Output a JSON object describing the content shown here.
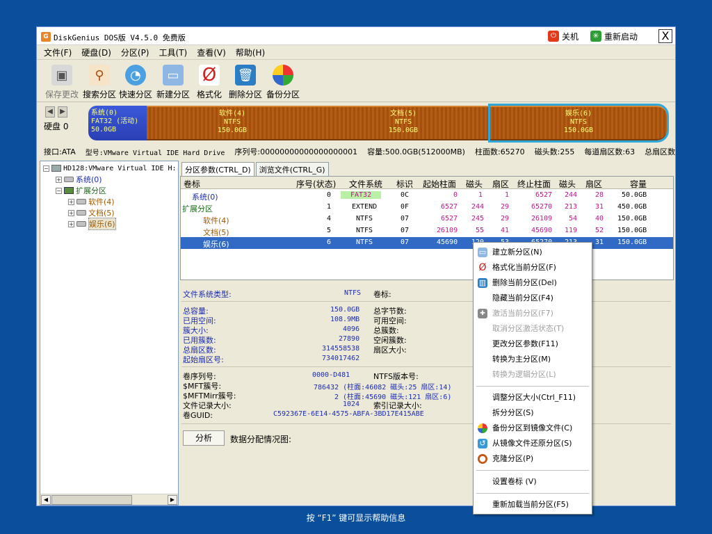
{
  "window": {
    "title": "DiskGenius DOS版 V4.5.0 免费版",
    "app_icon": "G",
    "shutdown_label": "关机",
    "restart_label": "重新启动",
    "close_label": "X"
  },
  "menu": [
    "文件(F)",
    "硬盘(D)",
    "分区(P)",
    "工具(T)",
    "查看(V)",
    "帮助(H)"
  ],
  "toolbar": [
    "保存更改",
    "搜索分区",
    "快速分区",
    "新建分区",
    "格式化",
    "删除分区",
    "备份分区"
  ],
  "diskbar": {
    "disk_label": "硬盘 0",
    "prev_arrow": "◀",
    "next_arrow": "▶",
    "parts": [
      {
        "name": "系统(0)",
        "fs": "FAT32 (活动)",
        "size": "50.0GB"
      },
      {
        "name": "软件(4)",
        "fs": "NTFS",
        "size": "150.0GB"
      },
      {
        "name": "文档(5)",
        "fs": "NTFS",
        "size": "150.0GB"
      },
      {
        "name": "娱乐(6)",
        "fs": "NTFS",
        "size": "150.0GB"
      }
    ]
  },
  "infoline": {
    "iface": "接口:ATA",
    "model": "型号:VMware Virtual IDE Hard Drive",
    "serial": "序列号:00000000000000000001",
    "capacity": "容量:500.0GB(512000MB)",
    "cylinders": "柱面数:65270",
    "heads": "磁头数:255",
    "sectors_per_track": "每道扇区数:63",
    "total_sectors": "总扇区数:"
  },
  "tree": {
    "root": "HD128:VMware Virtual IDE H:",
    "items": [
      "系统(0)",
      "扩展分区",
      "软件(4)",
      "文档(5)",
      "娱乐(6)"
    ],
    "collapse": "−",
    "expand": "+",
    "scroll_left": "◀",
    "scroll_right": "▶"
  },
  "tabs": [
    "分区参数(CTRL_D)",
    "浏览文件(CTRL_G)"
  ],
  "grid": {
    "headers": [
      "卷标",
      "序号(状态)",
      "文件系统",
      "标识",
      "起始柱面",
      "磁头",
      "扇区",
      "终止柱面",
      "磁头",
      "扇区",
      "容量"
    ],
    "rows": [
      [
        "系统(0)",
        "0",
        "FAT32",
        "0C",
        "0",
        "1",
        "1",
        "6527",
        "244",
        "28",
        "50.0GB"
      ],
      [
        "扩展分区",
        "1",
        "EXTEND",
        "0F",
        "6527",
        "244",
        "29",
        "65270",
        "213",
        "31",
        "450.0GB"
      ],
      [
        "软件(4)",
        "4",
        "NTFS",
        "07",
        "6527",
        "245",
        "29",
        "26109",
        "54",
        "40",
        "150.0GB"
      ],
      [
        "文档(5)",
        "5",
        "NTFS",
        "07",
        "26109",
        "55",
        "41",
        "45690",
        "119",
        "52",
        "150.0GB"
      ],
      [
        "娱乐(6)",
        "6",
        "NTFS",
        "07",
        "45690",
        "120",
        "53",
        "65270",
        "213",
        "31",
        "150.0GB"
      ]
    ]
  },
  "details": {
    "fs_type_label": "文件系统类型:",
    "fs_type": "NTFS",
    "volume_label_label": "卷标:",
    "left_labels": [
      "总容量:",
      "已用空间:",
      "簇大小:",
      "已用簇数:",
      "总扇区数:",
      "起始扇区号:"
    ],
    "left_values": [
      "150.0GB",
      "108.9MB",
      "4096",
      "27890",
      "314558538",
      "734017462"
    ],
    "mid_labels": [
      "总字节数:",
      "可用空间:",
      "总簇数:",
      "空闲簇数:",
      "扇区大小:"
    ],
    "ntfs_labels": [
      "卷序列号:",
      "$MFT簇号:",
      "$MFTMirr簇号:",
      "文件记录大小:",
      "卷GUID:"
    ],
    "ntfs_values": [
      "0000-D481",
      "786432 (柱面:46082 磁头:25 扇区:14)",
      "2 (柱面:45690 磁头:121 扇区:6)",
      "1024",
      "C592367E-6E14-4575-ABFA-3BD17E415ABE"
    ],
    "ntfs_mid_labels": [
      "NTFS版本号:",
      "",
      "",
      "索引记录大小:"
    ],
    "analyze_button": "分析",
    "analyze_label": "数据分配情况图:"
  },
  "context_menu": [
    {
      "label": "建立新分区(N)",
      "enabled": true
    },
    {
      "label": "格式化当前分区(F)",
      "enabled": true
    },
    {
      "label": "删除当前分区(Del)",
      "enabled": true
    },
    {
      "label": "隐藏当前分区(F4)",
      "enabled": true
    },
    {
      "label": "激活当前分区(F7)",
      "enabled": false
    },
    {
      "label": "取消分区激活状态(T)",
      "enabled": false
    },
    {
      "label": "更改分区参数(F11)",
      "enabled": true
    },
    {
      "label": "转换为主分区(M)",
      "enabled": true
    },
    {
      "label": "转换为逻辑分区(L)",
      "enabled": false
    },
    {
      "label": "调整分区大小(Ctrl_F11)",
      "enabled": true
    },
    {
      "label": "拆分分区(S)",
      "enabled": true
    },
    {
      "label": "备份分区到镜像文件(C)",
      "enabled": true
    },
    {
      "label": "从镜像文件还原分区(S)",
      "enabled": true
    },
    {
      "label": "克隆分区(P)",
      "enabled": true
    },
    {
      "label": "设置卷标 (V)",
      "enabled": true
    },
    {
      "label": "重新加载当前分区(F5)",
      "enabled": true
    }
  ],
  "status": "按 “F1” 键可显示帮助信息",
  "icons": {
    "save": "save-icon",
    "search": "magnifier-icon",
    "quick": "quick-partition-icon",
    "new": "new-partition-icon",
    "format": "format-icon",
    "delete": "trash-icon",
    "backup": "backup-icon"
  }
}
